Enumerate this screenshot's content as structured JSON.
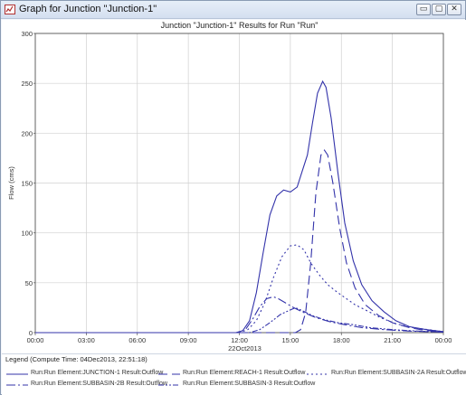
{
  "window": {
    "title": "Graph for Junction \"Junction-1\"",
    "controls": {
      "minimize": "▭",
      "maximize": "▢",
      "close": "✕"
    }
  },
  "chart_data": {
    "type": "line",
    "title": "Junction \"Junction-1\" Results for Run \"Run\"",
    "ylabel": "Flow (cms)",
    "xlabel": "22Oct2013",
    "ylim": [
      0,
      300
    ],
    "xlim": [
      0,
      24
    ],
    "x_unit": "hours from 22Oct2013 00:00",
    "grid": true,
    "yticks": [
      0,
      50,
      100,
      150,
      200,
      250,
      300
    ],
    "xticks": [
      {
        "t": 0,
        "label": "00:00"
      },
      {
        "t": 3,
        "label": "03:00"
      },
      {
        "t": 6,
        "label": "06:00"
      },
      {
        "t": 9,
        "label": "09:00"
      },
      {
        "t": 12,
        "label": "12:00"
      },
      {
        "t": 15,
        "label": "15:00"
      },
      {
        "t": 18,
        "label": "18:00"
      },
      {
        "t": 21,
        "label": "21:00"
      },
      {
        "t": 24,
        "label": "00:00"
      }
    ],
    "series": [
      {
        "name": "Run:Run Element:JUNCTION-1 Result:Outflow",
        "dash": "none",
        "color": "#3333aa",
        "points": [
          [
            0,
            0
          ],
          [
            11.8,
            0
          ],
          [
            12.2,
            2
          ],
          [
            12.6,
            12
          ],
          [
            13.0,
            40
          ],
          [
            13.4,
            80
          ],
          [
            13.8,
            118
          ],
          [
            14.2,
            137
          ],
          [
            14.6,
            143
          ],
          [
            15.0,
            141
          ],
          [
            15.4,
            146
          ],
          [
            15.7,
            162
          ],
          [
            16.0,
            178
          ],
          [
            16.3,
            210
          ],
          [
            16.6,
            240
          ],
          [
            16.9,
            252
          ],
          [
            17.1,
            246
          ],
          [
            17.4,
            215
          ],
          [
            17.8,
            160
          ],
          [
            18.2,
            110
          ],
          [
            18.7,
            72
          ],
          [
            19.2,
            48
          ],
          [
            19.8,
            32
          ],
          [
            20.5,
            21
          ],
          [
            21.2,
            12
          ],
          [
            22.0,
            6
          ],
          [
            23.0,
            3
          ],
          [
            24.0,
            1
          ]
        ]
      },
      {
        "name": "Run:Run Element:REACH-1 Result:Outflow",
        "dash": "10,5",
        "color": "#3333aa",
        "points": [
          [
            0,
            0
          ],
          [
            15.3,
            0
          ],
          [
            15.6,
            3
          ],
          [
            15.9,
            20
          ],
          [
            16.2,
            70
          ],
          [
            16.5,
            140
          ],
          [
            16.8,
            178
          ],
          [
            17.0,
            183
          ],
          [
            17.2,
            178
          ],
          [
            17.5,
            150
          ],
          [
            17.9,
            105
          ],
          [
            18.3,
            70
          ],
          [
            18.8,
            45
          ],
          [
            19.4,
            28
          ],
          [
            20.2,
            17
          ],
          [
            21.0,
            10
          ],
          [
            22.0,
            5
          ],
          [
            23.0,
            2
          ],
          [
            24.0,
            1
          ]
        ]
      },
      {
        "name": "Run:Run Element:SUBBASIN-2A Result:Outflow",
        "dash": "2,3",
        "color": "#3333aa",
        "points": [
          [
            0,
            0
          ],
          [
            12.0,
            0
          ],
          [
            12.5,
            3
          ],
          [
            13.0,
            12
          ],
          [
            13.5,
            30
          ],
          [
            14.0,
            55
          ],
          [
            14.5,
            76
          ],
          [
            15.0,
            87
          ],
          [
            15.4,
            88
          ],
          [
            15.8,
            83
          ],
          [
            16.2,
            70
          ],
          [
            16.7,
            58
          ],
          [
            17.2,
            48
          ],
          [
            17.8,
            40
          ],
          [
            18.3,
            34
          ],
          [
            18.8,
            28
          ],
          [
            19.5,
            22
          ],
          [
            20.3,
            15
          ],
          [
            21.2,
            9
          ],
          [
            22.2,
            5
          ],
          [
            24.0,
            1
          ]
        ]
      },
      {
        "name": "Run:Run Element:SUBBASIN-2B Result:Outflow",
        "dash": "10,3,2,3",
        "color": "#3333aa",
        "points": [
          [
            0,
            0
          ],
          [
            12.0,
            0
          ],
          [
            12.4,
            4
          ],
          [
            12.8,
            14
          ],
          [
            13.2,
            26
          ],
          [
            13.6,
            34
          ],
          [
            14.0,
            36
          ],
          [
            14.3,
            34
          ],
          [
            14.7,
            30
          ],
          [
            15.2,
            25
          ],
          [
            15.8,
            20
          ],
          [
            16.5,
            15
          ],
          [
            17.3,
            11
          ],
          [
            18.2,
            8
          ],
          [
            19.2,
            5
          ],
          [
            20.5,
            3
          ],
          [
            22.0,
            1.5
          ],
          [
            24.0,
            0.5
          ]
        ]
      },
      {
        "name": "Run:Run Element:SUBBASIN-3 Result:Outflow",
        "dash": "6,2,2,2,2,2",
        "color": "#3333aa",
        "points": [
          [
            0,
            0
          ],
          [
            12.6,
            0
          ],
          [
            13.2,
            3
          ],
          [
            13.8,
            10
          ],
          [
            14.4,
            18
          ],
          [
            14.9,
            22
          ],
          [
            15.3,
            25
          ],
          [
            15.7,
            22
          ],
          [
            16.3,
            17
          ],
          [
            17.0,
            13
          ],
          [
            17.8,
            10
          ],
          [
            18.7,
            8
          ],
          [
            19.7,
            5
          ],
          [
            21.0,
            3
          ],
          [
            22.5,
            1.5
          ],
          [
            24.0,
            0.5
          ]
        ]
      }
    ]
  },
  "legend": {
    "title": "Legend (Compute Time: 04Dec2013, 22:51:18)"
  }
}
